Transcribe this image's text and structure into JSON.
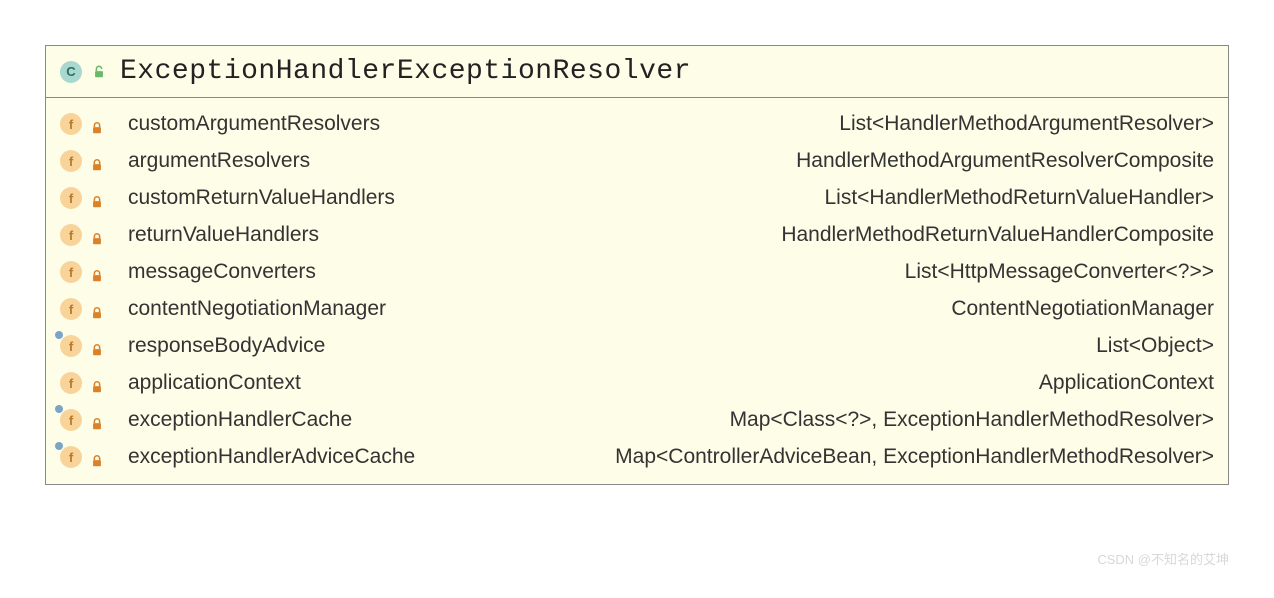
{
  "header": {
    "class_icon_letter": "C",
    "class_name": "ExceptionHandlerExceptionResolver"
  },
  "fields": [
    {
      "icon_letter": "f",
      "marked": false,
      "name": "customArgumentResolvers",
      "type": "List<HandlerMethodArgumentResolver>"
    },
    {
      "icon_letter": "f",
      "marked": false,
      "name": "argumentResolvers",
      "type": "HandlerMethodArgumentResolverComposite"
    },
    {
      "icon_letter": "f",
      "marked": false,
      "name": "customReturnValueHandlers",
      "type": "List<HandlerMethodReturnValueHandler>"
    },
    {
      "icon_letter": "f",
      "marked": false,
      "name": "returnValueHandlers",
      "type": "HandlerMethodReturnValueHandlerComposite"
    },
    {
      "icon_letter": "f",
      "marked": false,
      "name": "messageConverters",
      "type": "List<HttpMessageConverter<?>>"
    },
    {
      "icon_letter": "f",
      "marked": false,
      "name": "contentNegotiationManager",
      "type": "ContentNegotiationManager"
    },
    {
      "icon_letter": "f",
      "marked": true,
      "name": "responseBodyAdvice",
      "type": "List<Object>"
    },
    {
      "icon_letter": "f",
      "marked": false,
      "name": "applicationContext",
      "type": "ApplicationContext"
    },
    {
      "icon_letter": "f",
      "marked": true,
      "name": "exceptionHandlerCache",
      "type": "Map<Class<?>, ExceptionHandlerMethodResolver>"
    },
    {
      "icon_letter": "f",
      "marked": true,
      "name": "exceptionHandlerAdviceCache",
      "type": "Map<ControllerAdviceBean, ExceptionHandlerMethodResolver>"
    }
  ],
  "watermark": "CSDN @不知名的艾坤"
}
